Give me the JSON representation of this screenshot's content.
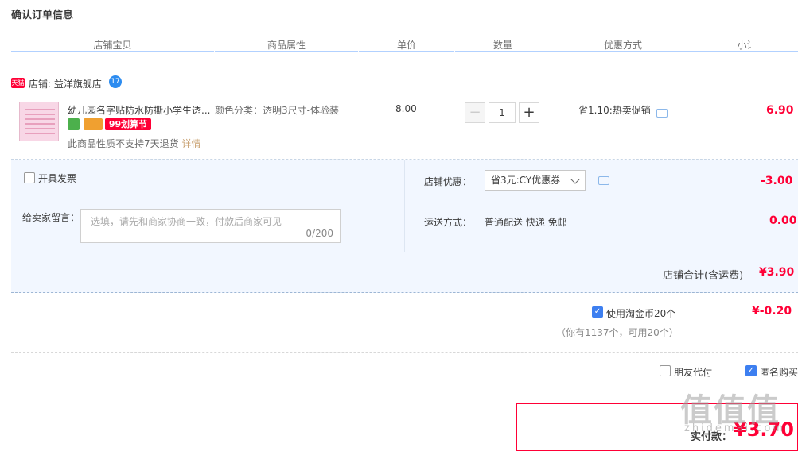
{
  "page": {
    "title": "确认订单信息"
  },
  "columns": [
    "店铺宝贝",
    "商品属性",
    "单价",
    "数量",
    "优惠方式",
    "小计"
  ],
  "shop": {
    "badge": "天猫",
    "label": "店铺: 益洋旗舰店",
    "ww_badge": "17"
  },
  "item": {
    "name": "幼儿园名字贴防水防撕小学生透...",
    "attr": "颜色分类：透明3尺寸-体验装",
    "badge_sale": "99划算节",
    "no_return": "此商品性质不支持7天退货",
    "detail_link": "详情",
    "price": "8.00",
    "quantity": "1",
    "minus": "−",
    "plus": "+",
    "promo": "省1.10:热卖促销",
    "subtotal": "6.90"
  },
  "invoice": {
    "label": "开具发票"
  },
  "message": {
    "label": "给卖家留言：",
    "placeholder": "选填，请先和商家协商一致，付款后商家可见",
    "count": "0/200"
  },
  "coupon": {
    "label": "店铺优惠：",
    "selected": "省3元:CY优惠券",
    "amount": "-3.00"
  },
  "shipping": {
    "label": "运送方式：",
    "value": "普通配送 快递 免邮",
    "amount": "0.00"
  },
  "shop_total": {
    "label": "店铺合计(含运费)",
    "amount": "¥3.90"
  },
  "coins": {
    "label": "使用淘金币20个",
    "amount": "¥-0.20",
    "info": "（你有1137个，可用20个）"
  },
  "options": {
    "friend_pay": "朋友代付",
    "anonymous": "匿名购买"
  },
  "payment": {
    "label": "实付款：",
    "amount": "¥3.70"
  },
  "watermark": {
    "big": "值值值",
    "small": "zhidemai.com"
  },
  "colors": {
    "accent_red": "#ff0036",
    "header_line": "#b2d1ff",
    "panel_bg": "#f2f7ff",
    "check_blue": "#3d7ff0"
  }
}
